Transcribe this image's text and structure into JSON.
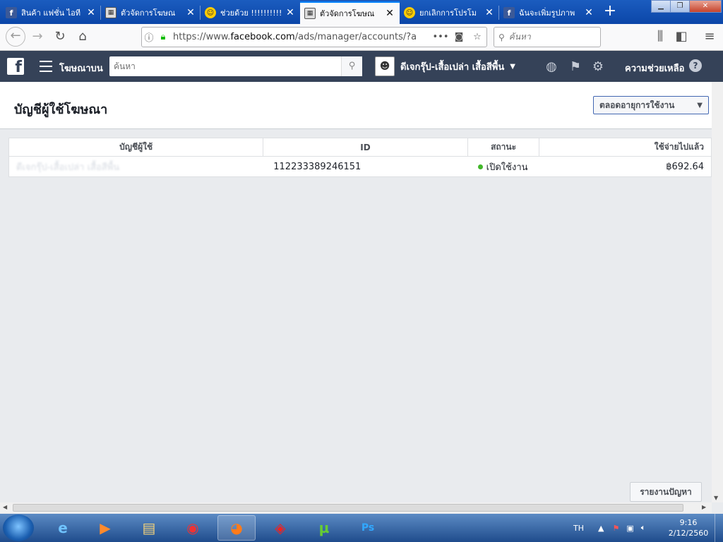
{
  "browser": {
    "tabs": [
      {
        "favicon": "facebook-icon",
        "title": "สินค้า แฟชั่น ไอที"
      },
      {
        "favicon": "document-icon",
        "title": "ตัวจัดการโฆษณ"
      },
      {
        "favicon": "smiley-icon",
        "title": "ช่วยด้วย !!!!!!!!!!"
      },
      {
        "favicon": "document-icon",
        "title": "ตัวจัดการโฆษณ"
      },
      {
        "favicon": "smiley-icon",
        "title": "ยกเลิกการโปรโม"
      },
      {
        "favicon": "facebook-icon",
        "title": "ฉันจะเพิ่มรูปภาพ"
      }
    ],
    "active_tab_index": 3,
    "new_tab": "+",
    "url_prefix": "https://www.",
    "url_domain": "facebook.com",
    "url_path": "/ads/manager/accounts/?a",
    "search_placeholder": "ค้นหา"
  },
  "fb": {
    "section_label": "โฆษณาบน",
    "search_placeholder": "ค้นหา",
    "account_name": "ดีเจกรุ๊ป-เสื้อเปล่า เสื้อสีพื้น",
    "help_label": "ความช่วยเหลือ"
  },
  "page": {
    "title": "บัญชีผู้ใช้โฆษณา",
    "date_filter": "ตลอดอายุการใช้งาน"
  },
  "table": {
    "headers": [
      "บัญชีผู้ใช้",
      "ID",
      "สถานะ",
      "ใช้จ่ายไปแล้ว"
    ],
    "rows": [
      {
        "account": "ดีเจกรุ๊ป-เสื้อเปล่า เสื้อสีพื้น",
        "id": "112233389246151",
        "status": "เปิดใช้งาน",
        "spent": "฿692.64"
      }
    ]
  },
  "report_button": "รายงานปัญหา",
  "taskbar": {
    "language": "TH",
    "time": "9:16",
    "date": "2/12/2560"
  },
  "colors": {
    "fb_bar": "#354258",
    "status_active": "#42b72a",
    "firefox_tabstrip": "#0b46a8"
  }
}
